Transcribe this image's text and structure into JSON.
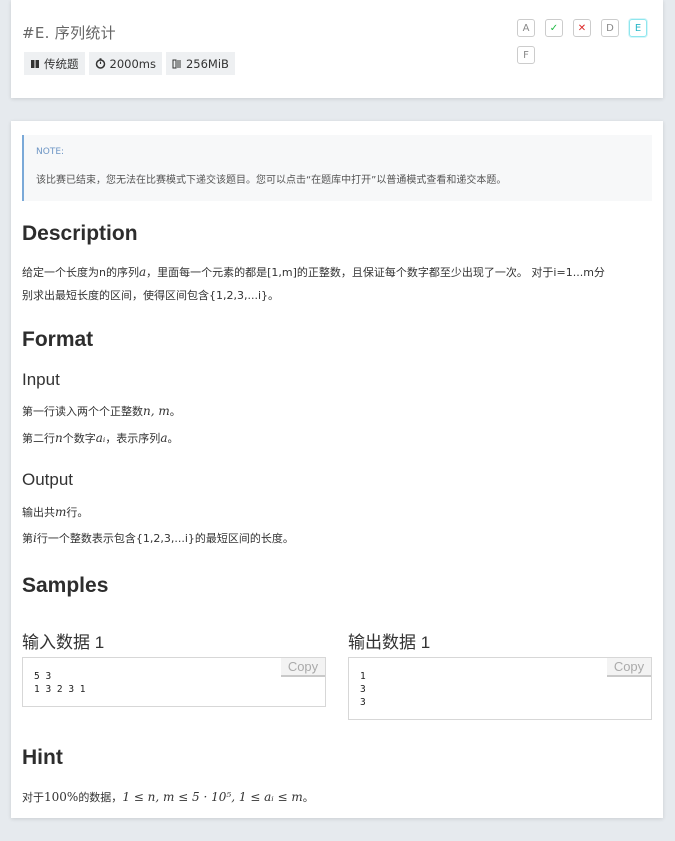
{
  "header": {
    "title": "#E. 序列统计",
    "tags": {
      "type": "传统题",
      "time": "2000ms",
      "memory": "256MiB"
    },
    "status_buttons": [
      {
        "label": "A",
        "kind": "letter"
      },
      {
        "label": "✓",
        "kind": "accepted",
        "color": "#21ba45"
      },
      {
        "label": "✕",
        "kind": "wrong",
        "color": "#db2828"
      },
      {
        "label": "D",
        "kind": "letter"
      },
      {
        "label": "E",
        "kind": "current",
        "color": "#2ab7c7"
      },
      {
        "label": "F",
        "kind": "letter"
      }
    ]
  },
  "note": {
    "title": "NOTE:",
    "text": "该比赛已结束，您无法在比赛模式下递交该题目。您可以点击“在题库中打开”以普通模式查看和递交本题。"
  },
  "description": {
    "heading": "Description",
    "line1_pre": "给定一个长度为n的序列",
    "line1_var": "a",
    "line1_post": "，里面每一个元素的都是[1,m]的正整数，且保证每个数字都至少出现了一次。 对于i=1...m分",
    "line2": "别求出最短长度的区间，使得区间包含{1,2,3,...i}。"
  },
  "format": {
    "heading": "Format",
    "input_heading": "Input",
    "input_line1_pre": "第一行读入两个个正整数",
    "input_line1_math": "n, m",
    "input_line1_post": "。",
    "input_line2_pre": "第二行",
    "input_line2_var": "n",
    "input_line2_mid": "个数字",
    "input_line2_math": "aᵢ",
    "input_line2_mid2": "，表示序列",
    "input_line2_var2": "a",
    "input_line2_post": "。",
    "output_heading": "Output",
    "output_line1_pre": "输出共",
    "output_line1_var": "m",
    "output_line1_post": "行。",
    "output_line2_pre": "第",
    "output_line2_var": "i",
    "output_line2_post": "行一个整数表示包含{1,2,3,...i}的最短区间的长度。"
  },
  "samples": {
    "heading": "Samples",
    "input_label": "输入数据 1",
    "input_data": "5 3\n1 3 2 3 1",
    "output_label": "输出数据 1",
    "output_data": "1\n3\n3",
    "copy_label": "Copy"
  },
  "hint": {
    "heading": "Hint",
    "pre": "对于",
    "percent": "100%",
    "mid": "的数据，",
    "math": "1 ≤ n, m ≤ 5 · 10⁵, 1 ≤ aᵢ ≤ m",
    "post": "。"
  }
}
